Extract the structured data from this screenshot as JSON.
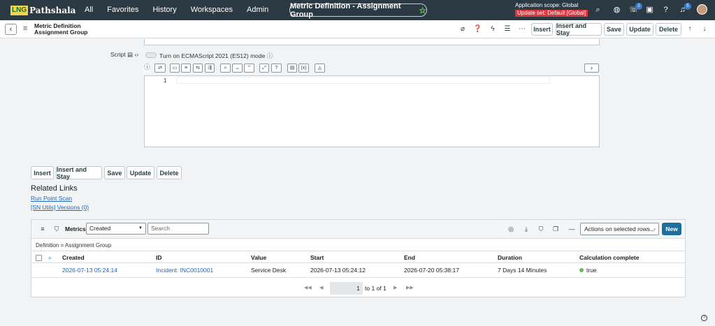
{
  "topnav": {
    "logo_box": "LNG",
    "logo_name": "Pathshala",
    "links": [
      "All",
      "Favorites",
      "History",
      "Workspaces",
      "Admin"
    ],
    "record_title": "Metric Definition - Assignment Group",
    "scope": "Application scope: Global",
    "update_set": "Update set: Default [Global]",
    "chat_badge": "2",
    "notif_badge": "5"
  },
  "form_header": {
    "title_line1": "Metric Definition",
    "title_line2": "Assignment Group",
    "buttons": [
      "Insert",
      "Insert and Stay",
      "Save",
      "Update",
      "Delete"
    ]
  },
  "script_field": {
    "label": "Script",
    "toggle_label": "Turn on ECMAScript 2021 (ES12) mode",
    "line_number": "1"
  },
  "bottom_buttons": [
    "Insert",
    "Insert and Stay",
    "Save",
    "Update",
    "Delete"
  ],
  "related_links": {
    "heading": "Related Links",
    "links": [
      "Run Point Scan",
      "[SN Utils] Versions (0)"
    ]
  },
  "related_list": {
    "title": "Metrics",
    "search_field": "Created",
    "search_placeholder": "Search",
    "actions": "Actions on selected rows...",
    "new_label": "New",
    "filter": "Definition = Assignment Group",
    "columns": [
      "Created",
      "ID",
      "Value",
      "Start",
      "End",
      "Duration",
      "Calculation complete"
    ],
    "rows": [
      {
        "created": "2026-07-13 05:24:14",
        "id": "Incident: INC0010001",
        "value": "Service Desk",
        "start": "2026-07-13 05:24:12",
        "end": "2026-07-20 05:38:17",
        "duration": "7 Days 14 Minutes",
        "calc": "true"
      }
    ],
    "pager": {
      "current": "1",
      "to": "to",
      "end": "1",
      "of": "of",
      "total": "1"
    }
  },
  "colors": {
    "nav_bg": "#2b3a42",
    "primary": "#1f6f9e",
    "link": "#2267b8",
    "update_set": "#d9363e"
  }
}
